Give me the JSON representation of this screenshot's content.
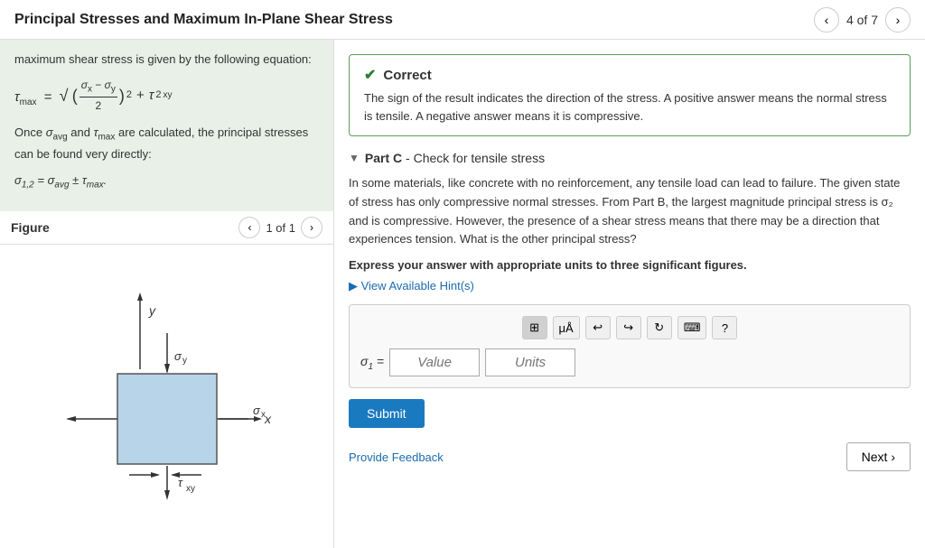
{
  "header": {
    "title": "Principal Stresses and Maximum In-Plane Shear Stress",
    "nav_count": "4 of 7",
    "prev_label": "‹",
    "next_label": "›"
  },
  "theory": {
    "line1": "maximum shear stress is given by the following equation:",
    "line2": "Once σ",
    "line2b": "avg",
    "line2c": " and τ",
    "line2d": "max",
    "line2e": " are calculated, the principal stresses can be found very directly:"
  },
  "figure": {
    "title": "Figure",
    "count": "1 of 1"
  },
  "correct": {
    "label": "Correct",
    "text": "The sign of the result indicates the direction of the stress. A positive answer means the normal stress is tensile. A negative answer means it is compressive."
  },
  "partC": {
    "label": "Part C",
    "dash": " - ",
    "subtitle": "Check for tensile stress",
    "body": "In some materials, like concrete with no reinforcement, any tensile load can lead to failure. The given state of stress has only compressive normal stresses. From Part B, the largest magnitude principal stress is σ₂ and is compressive. However, the presence of a shear stress means that there may be a direction that experiences tension. What is the other principal stress?",
    "instruction": "Express your answer with appropriate units to three significant figures.",
    "hint_label": "▶ View Available Hint(s)",
    "input_label": "σ₁ =",
    "value_placeholder": "Value",
    "units_placeholder": "Units",
    "submit_label": "Submit"
  },
  "footer": {
    "feedback_label": "Provide Feedback",
    "next_label": "Next ›"
  },
  "toolbar": {
    "btns": [
      "⊞",
      "μÅ",
      "↩",
      "↪",
      "↻",
      "⌨",
      "?"
    ]
  }
}
